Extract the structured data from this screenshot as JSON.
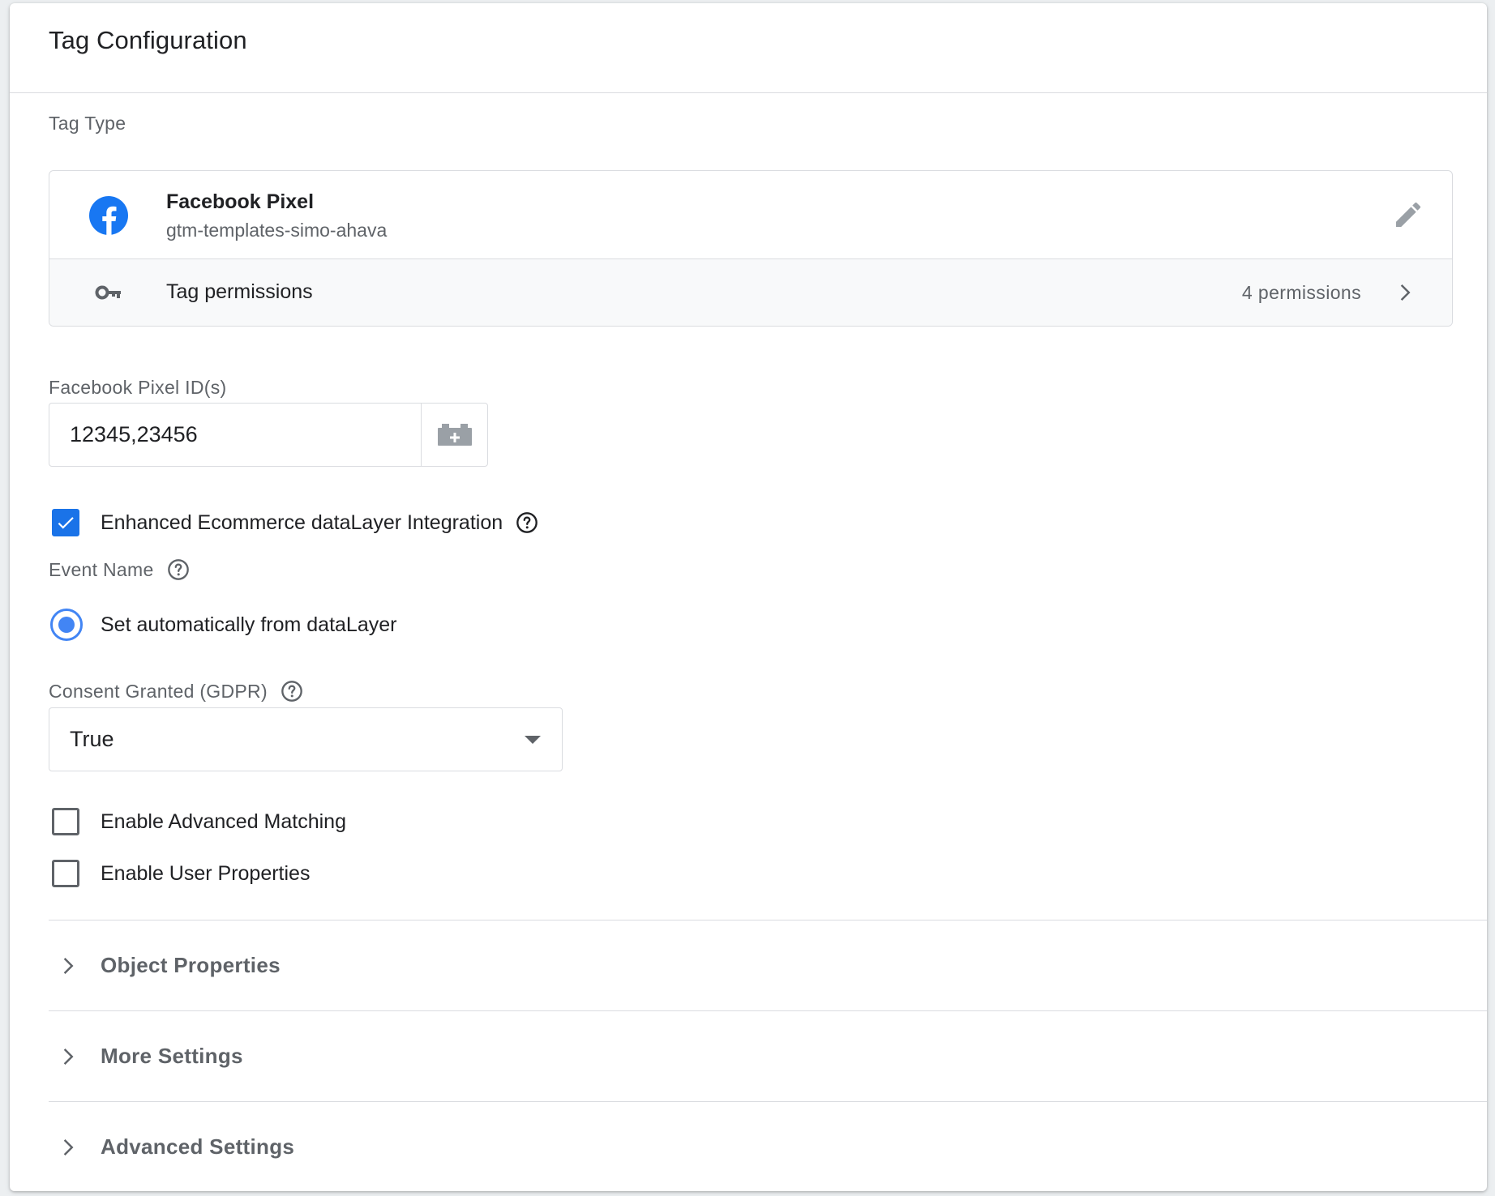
{
  "header": {
    "title": "Tag Configuration"
  },
  "tag_type": {
    "label": "Tag Type",
    "name": "Facebook Pixel",
    "source": "gtm-templates-simo-ahava",
    "icon": "facebook-icon",
    "edit_icon": "pencil-icon",
    "permissions": {
      "label": "Tag permissions",
      "count": "4 permissions",
      "icon": "key-icon"
    }
  },
  "pixel_id": {
    "label": "Facebook Pixel ID(s)",
    "value": "12345,23456",
    "variable_icon": "variable-picker-icon"
  },
  "ecommerce": {
    "label": "Enhanced Ecommerce dataLayer Integration",
    "checked": true
  },
  "event_name": {
    "label": "Event Name",
    "option_label": "Set automatically from dataLayer",
    "selected": true
  },
  "consent": {
    "label": "Consent Granted (GDPR)",
    "selected_value": "True"
  },
  "advanced_matching": {
    "label": "Enable Advanced Matching",
    "checked": false
  },
  "user_properties": {
    "label": "Enable User Properties",
    "checked": false
  },
  "sections": [
    {
      "label": "Object Properties"
    },
    {
      "label": "More Settings"
    },
    {
      "label": "Advanced Settings"
    }
  ],
  "colors": {
    "accent": "#1a73e8",
    "facebook": "#1877f2",
    "muted_text": "#5f6368",
    "border": "#dadce0"
  }
}
